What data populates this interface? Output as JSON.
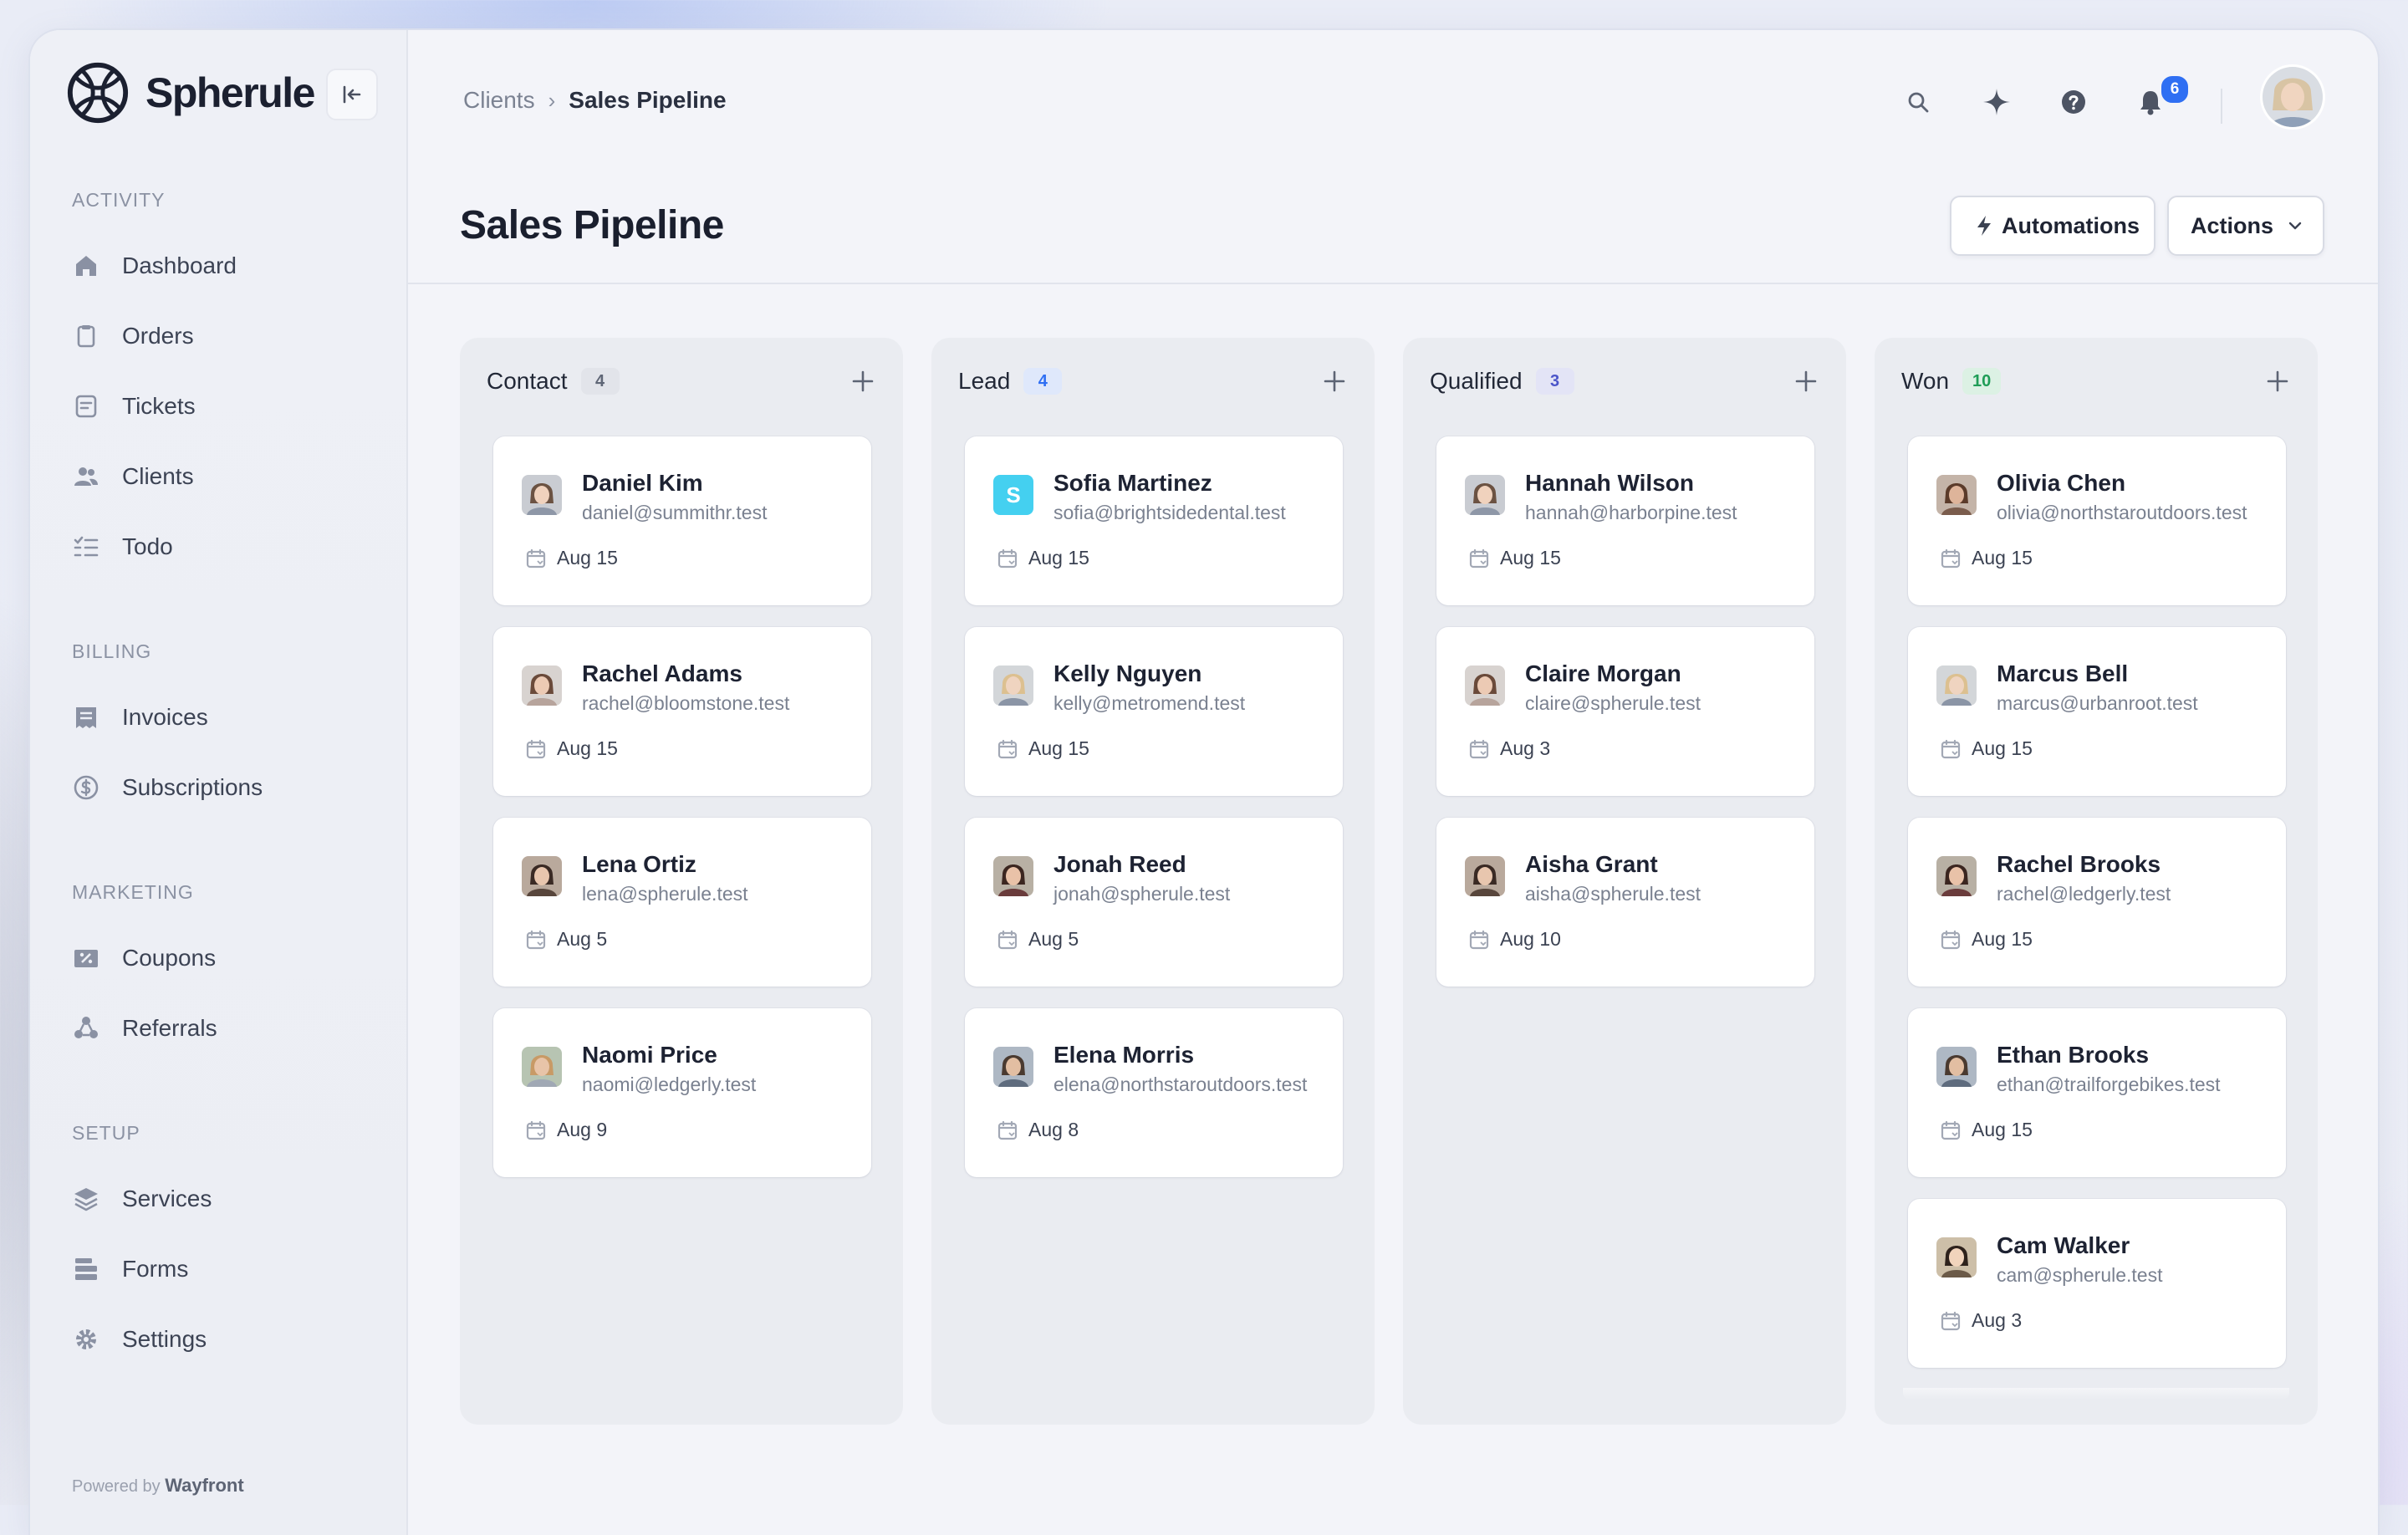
{
  "app": {
    "brand": "Spherule"
  },
  "sidebar": {
    "sections": [
      {
        "title": "ACTIVITY",
        "items": [
          {
            "label": "Dashboard",
            "icon": "home-icon"
          },
          {
            "label": "Orders",
            "icon": "clipboard-icon"
          },
          {
            "label": "Tickets",
            "icon": "ticket-icon"
          },
          {
            "label": "Clients",
            "icon": "users-icon"
          },
          {
            "label": "Todo",
            "icon": "checklist-icon"
          }
        ]
      },
      {
        "title": "BILLING",
        "items": [
          {
            "label": "Invoices",
            "icon": "invoice-icon"
          },
          {
            "label": "Subscriptions",
            "icon": "subscription-icon"
          }
        ]
      },
      {
        "title": "MARKETING",
        "items": [
          {
            "label": "Coupons",
            "icon": "coupon-icon"
          },
          {
            "label": "Referrals",
            "icon": "referral-icon"
          }
        ]
      },
      {
        "title": "SETUP",
        "items": [
          {
            "label": "Services",
            "icon": "layers-icon"
          },
          {
            "label": "Forms",
            "icon": "forms-icon"
          },
          {
            "label": "Settings",
            "icon": "gear-icon"
          }
        ]
      }
    ],
    "powered_prefix": "Powered by",
    "powered_brand": "Wayfront"
  },
  "header": {
    "breadcrumb": [
      "Clients",
      "Sales Pipeline"
    ],
    "notifications_count": "6",
    "title": "Sales Pipeline",
    "automations_label": "Automations",
    "actions_label": "Actions"
  },
  "colors": {
    "accent": "#2f6ff3",
    "contact": "#6b7280",
    "lead": "#2f6ff3",
    "qualified": "#4b55c9",
    "won": "#1f9d57"
  },
  "columns": [
    {
      "title": "Contact",
      "count": "4",
      "cards": [
        {
          "name": "Daniel Kim",
          "email": "daniel@summithr.test",
          "date": "Aug 15"
        },
        {
          "name": "Rachel Adams",
          "email": "rachel@bloomstone.test",
          "date": "Aug 15"
        },
        {
          "name": "Lena Ortiz",
          "email": "lena@spherule.test",
          "date": "Aug 5"
        },
        {
          "name": "Naomi Price",
          "email": "naomi@ledgerly.test",
          "date": "Aug 9"
        }
      ]
    },
    {
      "title": "Lead",
      "count": "4",
      "cards": [
        {
          "name": "Sofia Martinez",
          "email": "sofia@brightsidedental.test",
          "date": "Aug 15",
          "initial": "S"
        },
        {
          "name": "Kelly Nguyen",
          "email": "kelly@metromend.test",
          "date": "Aug 15"
        },
        {
          "name": "Jonah Reed",
          "email": "jonah@spherule.test",
          "date": "Aug 5"
        },
        {
          "name": "Elena Morris",
          "email": "elena@northstaroutdoors.test",
          "date": "Aug 8"
        }
      ]
    },
    {
      "title": "Qualified",
      "count": "3",
      "cards": [
        {
          "name": "Hannah Wilson",
          "email": "hannah@harborpine.test",
          "date": "Aug 15"
        },
        {
          "name": "Claire Morgan",
          "email": "claire@spherule.test",
          "date": "Aug 3"
        },
        {
          "name": "Aisha Grant",
          "email": "aisha@spherule.test",
          "date": "Aug 10"
        }
      ]
    },
    {
      "title": "Won",
      "count": "10",
      "cards": [
        {
          "name": "Olivia Chen",
          "email": "olivia@northstaroutdoors.test",
          "date": "Aug 15"
        },
        {
          "name": "Marcus Bell",
          "email": "marcus@urbanroot.test",
          "date": "Aug 15"
        },
        {
          "name": "Rachel Brooks",
          "email": "rachel@ledgerly.test",
          "date": "Aug 15"
        },
        {
          "name": "Ethan Brooks",
          "email": "ethan@trailforgebikes.test",
          "date": "Aug 15"
        },
        {
          "name": "Cam Walker",
          "email": "cam@spherule.test",
          "date": "Aug 3"
        }
      ]
    }
  ]
}
